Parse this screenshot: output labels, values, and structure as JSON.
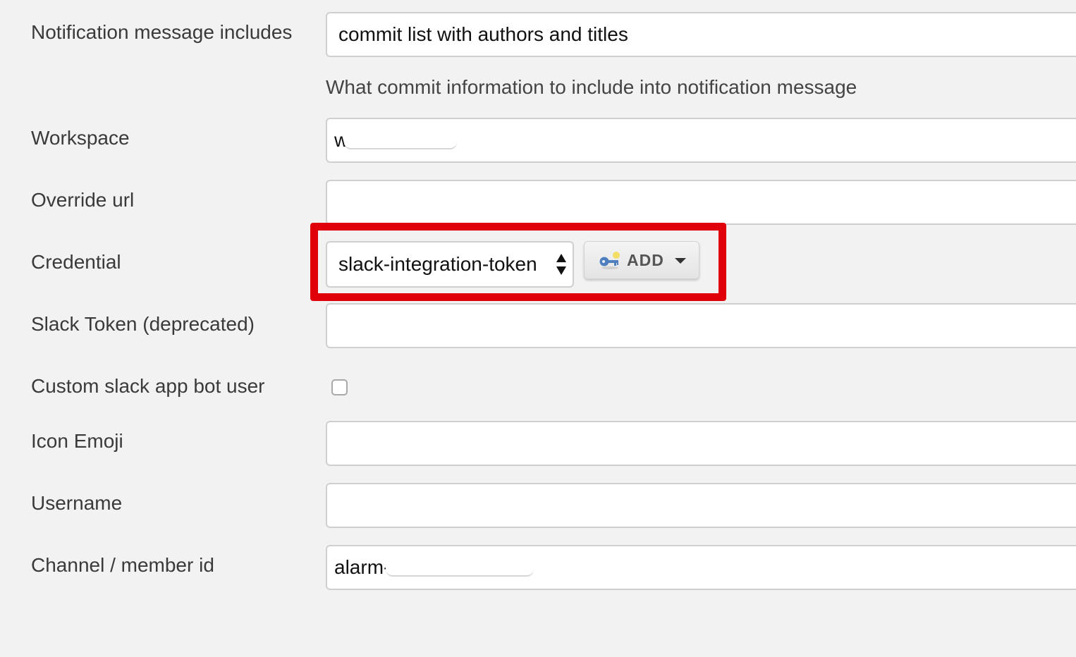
{
  "form": {
    "notification": {
      "label": "Notification message includes",
      "value": "commit list with authors and titles",
      "help": "What commit information to include into notification message"
    },
    "workspace": {
      "label": "Workspace",
      "value": "w"
    },
    "override_url": {
      "label": "Override url",
      "value": ""
    },
    "credential": {
      "label": "Credential",
      "selected": "slack-integration-token",
      "add_label": "ADD",
      "add_icon": "key-icon",
      "highlight_color": "#e0000a"
    },
    "slack_token": {
      "label": "Slack Token (deprecated)",
      "value": ""
    },
    "custom_bot": {
      "label": "Custom slack app bot user",
      "checked": false
    },
    "icon_emoji": {
      "label": "Icon Emoji",
      "value": ""
    },
    "username": {
      "label": "Username",
      "value": ""
    },
    "channel": {
      "label": "Channel / member id",
      "value": "alarm-"
    }
  }
}
